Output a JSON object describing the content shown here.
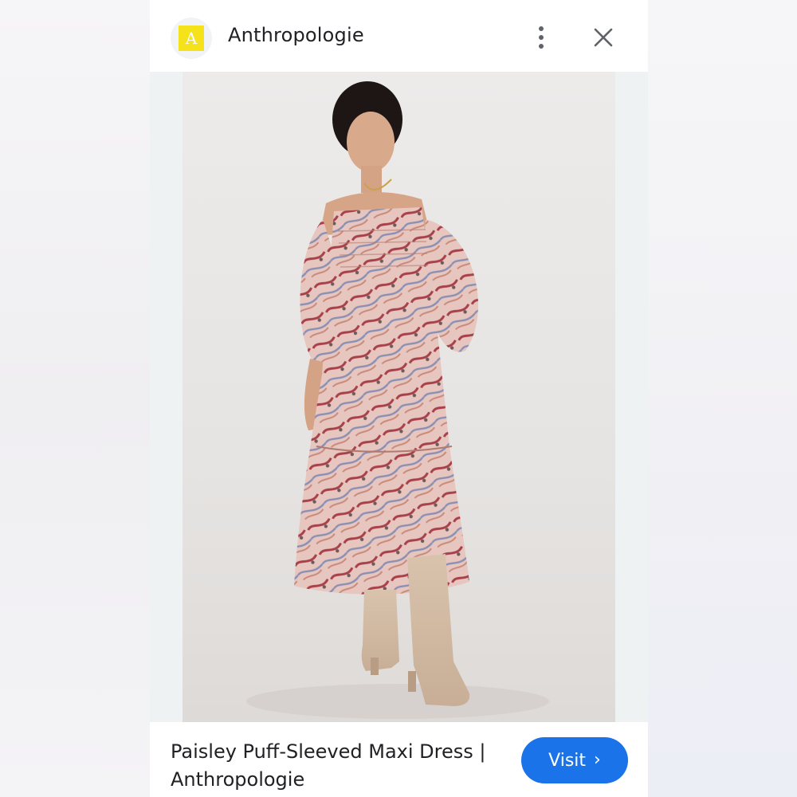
{
  "header": {
    "brand_initial": "A",
    "site_name": "Anthropologie",
    "menu_icon": "more-vert-icon",
    "close_icon": "close-icon"
  },
  "product": {
    "title": "Paisley Puff-Sleeved Maxi Dress | Anthropologie",
    "image_alt": "Model wearing a paisley puff-sleeved off-shoulder maxi dress with beige knee-high boots"
  },
  "footer": {
    "visit_label": "Visit",
    "visit_chevron": "›"
  },
  "colors": {
    "brand_yellow": "#f5e21a",
    "accent_blue": "#1a73e8",
    "text_primary": "#202124",
    "icon_gray": "#5f6368"
  }
}
